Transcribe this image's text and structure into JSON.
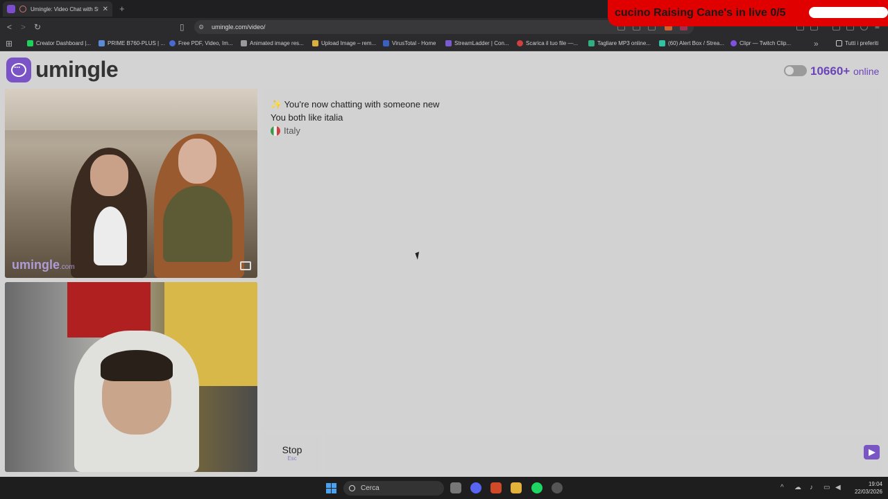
{
  "browser": {
    "tab_title": "Umingle: Video Chat with Str",
    "tab_close": "✕",
    "new_tab": "+",
    "url": "umingle.com/video/",
    "bookmarks": [
      {
        "label": "Creator Dashboard |...",
        "color": "#1fd05a"
      },
      {
        "label": "PRIME B760-PLUS | ...",
        "color": "#5b8ad6"
      },
      {
        "label": "Free PDF, Video, Im...",
        "color": "#4a6ad0"
      },
      {
        "label": "Animated image res...",
        "color": "#999999"
      },
      {
        "label": "Upload Image – rem...",
        "color": "#d8b040"
      },
      {
        "label": "VirusTotal - Home",
        "color": "#3a60c0"
      },
      {
        "label": "StreamLadder | Con...",
        "color": "#7a5ad0"
      },
      {
        "label": "Scarica il tuo file —...",
        "color": "#d04040"
      },
      {
        "label": "Tagliare MP3 online...",
        "color": "#30b080"
      },
      {
        "label": "(60) Alert Box / Strea...",
        "color": "#31c3a2"
      },
      {
        "label": "Clipr — Twitch Clip...",
        "color": "#8050e0"
      }
    ],
    "bookmarks_all": "Tutti i preferiti"
  },
  "overlay": {
    "text": "cucino Raising Cane's in live 0/5"
  },
  "site": {
    "logo_text": "umingle",
    "online_count": "10660+",
    "online_label": "online"
  },
  "video": {
    "watermark": "umingle",
    "watermark_suffix": ".com"
  },
  "chat": {
    "messages": [
      {
        "icon": "✨",
        "text": "You're now chatting with someone new"
      },
      {
        "icon": "",
        "text": "You both like italia"
      },
      {
        "icon": "",
        "text": "Italy"
      }
    ]
  },
  "controls": {
    "stop_label": "Stop",
    "stop_key": "Esc",
    "input_placeholder": ""
  },
  "taskbar": {
    "search_label": "Cerca",
    "time": "19:04",
    "date": "22/03/2026"
  },
  "colors": {
    "brand": "#7a54c7",
    "banner": "#e00000"
  }
}
